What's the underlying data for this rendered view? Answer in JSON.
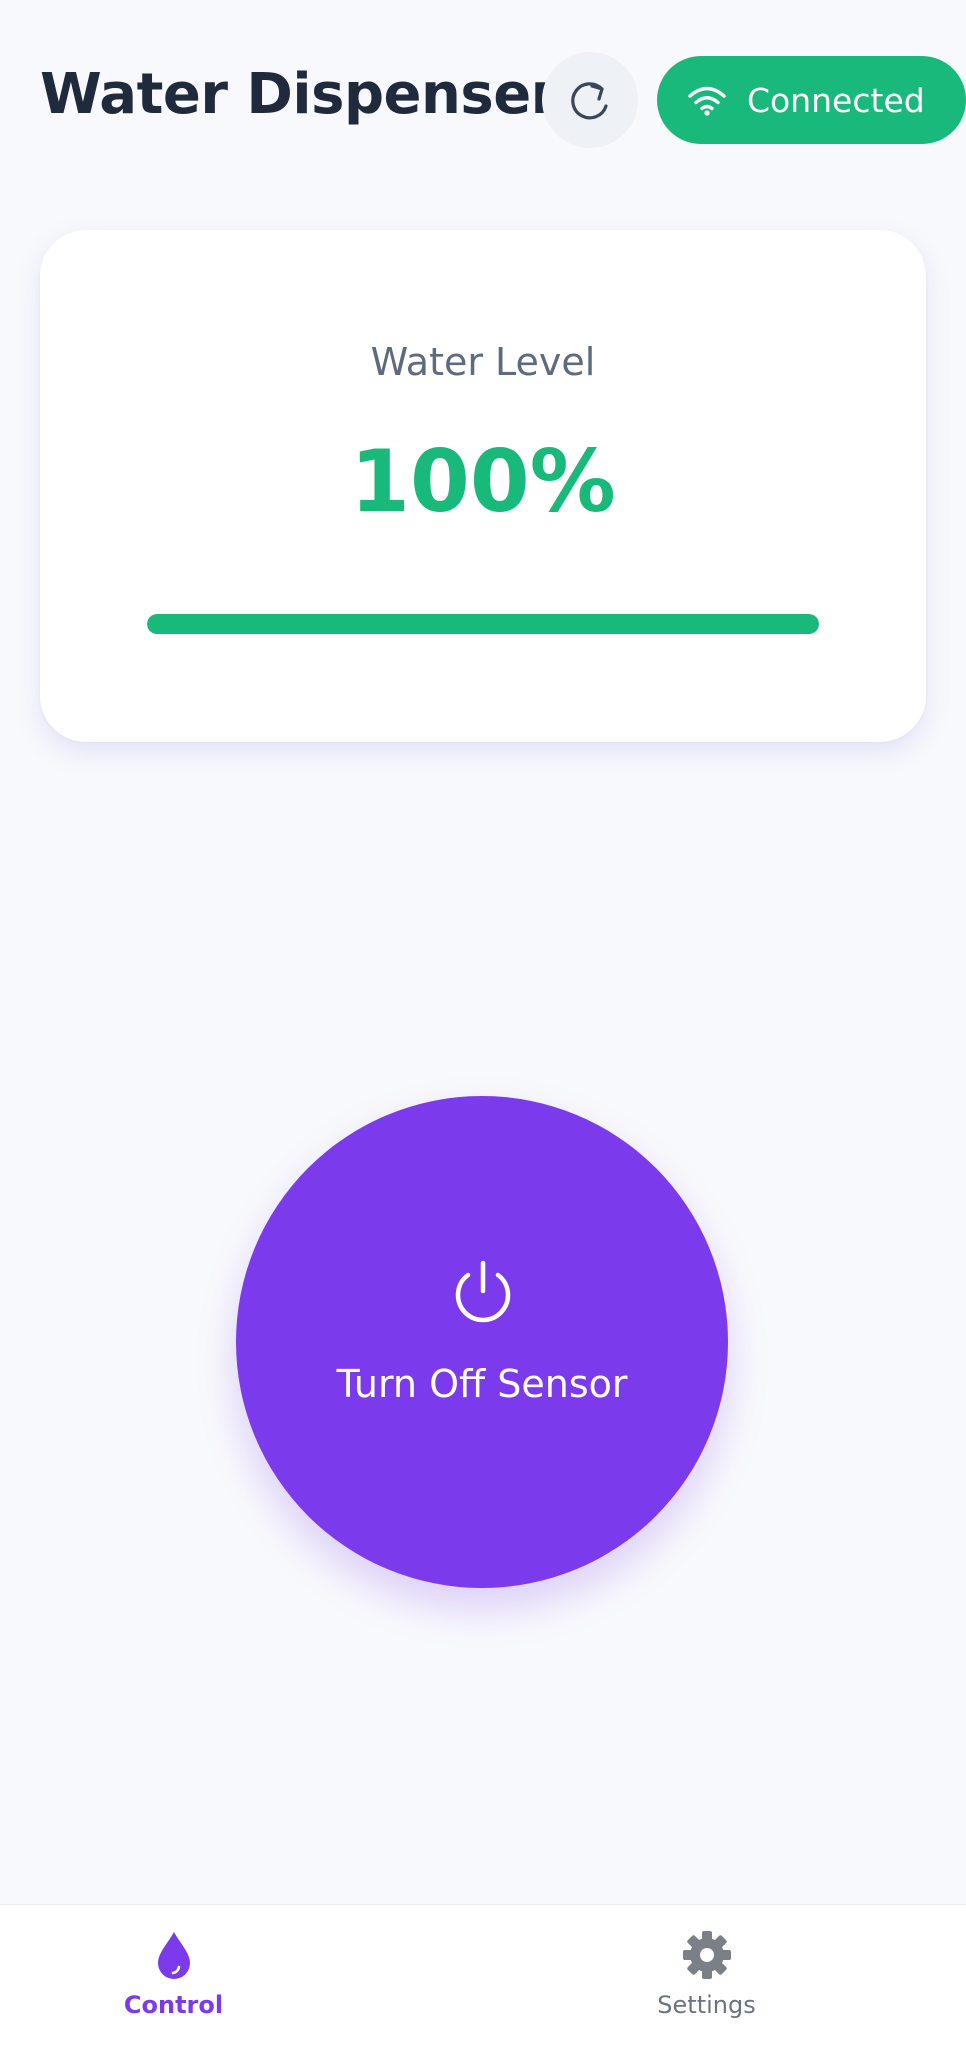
{
  "header": {
    "title": "Water Dispenser",
    "refresh_icon": "refresh-icon",
    "connection_status": "Connected",
    "connection_icon": "wifi-icon",
    "status_color": "#19b97b"
  },
  "water_level": {
    "label": "Water Level",
    "value_text": "100%",
    "fraction": 1.0,
    "color": "#19b97b"
  },
  "sensor": {
    "label": "Turn Off Sensor",
    "icon": "power-icon",
    "color": "#7c3aed"
  },
  "bottom_nav": {
    "items": [
      {
        "label": "Control",
        "icon": "water-drop-icon",
        "active": true
      },
      {
        "label": "Settings",
        "icon": "gear-icon",
        "active": false
      }
    ]
  }
}
